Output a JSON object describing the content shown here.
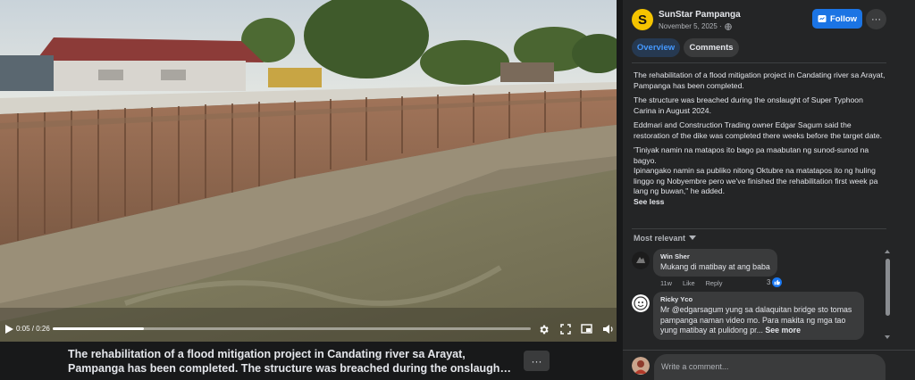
{
  "video": {
    "current_time": "0:05",
    "duration": "0:26",
    "time_display": "0:05 / 0:26",
    "progress": 0.19,
    "caption_line1": "The rehabilitation of a flood mitigation project in Candating river sa Arayat,",
    "caption_line2": "Pampanga has been completed. The structure was breached during the onslaught o...",
    "more_label": "···"
  },
  "post": {
    "page_avatar_letter": "S",
    "page_name": "SunStar Pampanga",
    "date": "November 5, 2025 ·",
    "follow_label": "Follow",
    "menu_label": "···",
    "tabs": [
      {
        "label": "Overview",
        "active": true
      },
      {
        "label": "Comments",
        "active": false
      }
    ],
    "paragraphs": [
      "The rehabilitation of a flood mitigation project in Candating river sa Arayat, Pampanga has been completed.",
      "The structure was breached during the onslaught of Super Typhoon Carina in August 2024.",
      "Eddmari and Construction Trading owner Edgar Sagum said the restoration of the dike was completed there weeks before the target date.",
      "'Tiniyak namin na matapos ito bago pa maabutan ng sunod-sunod na bagyo.",
      "Ipinangako namin sa publiko nitong Oktubre na matatapos ito ng huling linggo ng Nobyembre pero we've finished the rehabilitation first week pa lang ng buwan,\" he added."
    ],
    "see_less": "See less"
  },
  "comments_section": {
    "sort_label": "Most relevant",
    "comments": [
      {
        "name": "Win Sher",
        "text": "Mukang di matibay at ang baba",
        "time": "11w",
        "like": "Like",
        "reply": "Reply",
        "reactions": "3"
      },
      {
        "name": "Ricky Yco",
        "text": "Mr @edgarsagum yung sa dalaquitan bridge sto tomas pampanga naman video mo. Para makita ng mga tao yung matibay at pulidong pr...",
        "see_more": "See more"
      }
    ],
    "composer_placeholder": "Write a comment..."
  },
  "colors": {
    "accent": "#1b74e4",
    "background": "#18191a",
    "panel": "#242526",
    "bubble": "#3a3b3c",
    "brand_yellow": "#f5c400"
  },
  "icons": [
    "play-icon",
    "settings-icon",
    "fullscreen-icon",
    "pip-icon",
    "volume-icon",
    "globe-icon",
    "messenger-icon",
    "chevron-down-icon",
    "like-icon"
  ]
}
